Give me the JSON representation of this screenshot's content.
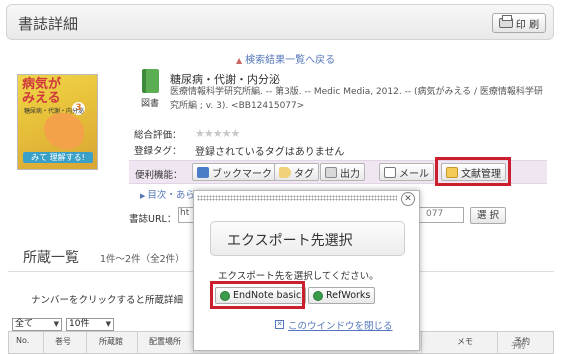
{
  "header": {
    "title": "書誌詳細",
    "print_label": "印 刷"
  },
  "back_link": "検索結果一覧へ戻る",
  "cover": {
    "title_line1": "病気が",
    "title_line2": "みえる",
    "number": "3",
    "subtitle": "糖尿病・代謝・内分泌",
    "footer": "みて 理解する!"
  },
  "book": {
    "type_label": "図書",
    "title": "糖尿病・代謝・内分泌",
    "description": "医療情報科学研究所編. -- 第3版. -- Medic Media, 2012. -- (病気がみえる / 医療情報科学研究所編 ; v. 3). <BB12415077>"
  },
  "fields": {
    "rating_label": "総合評価：",
    "rating_value": 0,
    "rating_max": 5,
    "tags_label": "登録タグ：",
    "tags_value": "登録されているタグはありません",
    "functions_label": "便利機能："
  },
  "functions": [
    {
      "label": "ブックマーク",
      "icon": "bookmark-icon"
    },
    {
      "label": "タグ",
      "icon": "tag-icon"
    },
    {
      "label": "出力",
      "icon": "output-icon"
    },
    {
      "label": "メール",
      "icon": "mail-icon"
    },
    {
      "label": "文献管理",
      "icon": "reference-manager-icon"
    }
  ],
  "toc_link": "目次・あらすじ",
  "url": {
    "label": "書誌URL：",
    "value_start": "ht",
    "value_end": "077",
    "select_label": "選 択"
  },
  "holdings": {
    "title": "所蔵一覧",
    "count": "1件～2件（全2件）",
    "note": "ナンバーをクリックすると所蔵詳細",
    "filter_all": "全て",
    "per_page": "10件",
    "columns": [
      "No.",
      "巻号",
      "所蔵館",
      "配置場所",
      "メモ",
      "予約"
    ],
    "reserve_sub": "予約"
  },
  "popup": {
    "title": "エクスポート先選択",
    "prompt": "エクスポート先を選択してください。",
    "endnote_label": "EndNote basic",
    "refworks_label": "RefWorks",
    "close_label": "このウインドウを閉じる"
  },
  "colors": {
    "highlight_red": "#cc1f2e",
    "link_blue": "#5577bb",
    "function_bar_bg": "#efe6f2"
  }
}
